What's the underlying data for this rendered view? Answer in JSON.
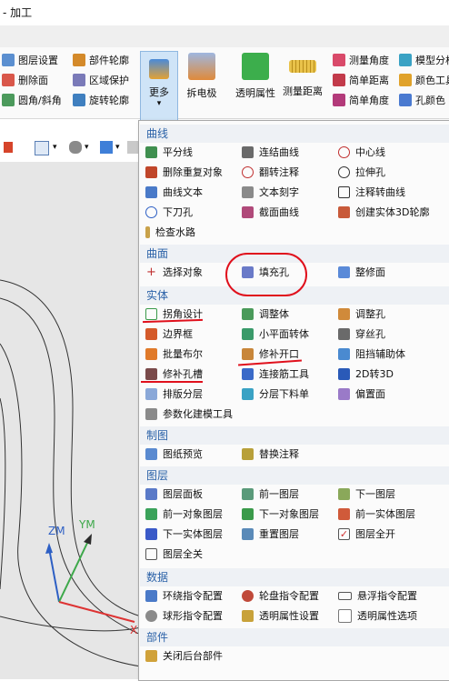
{
  "window": {
    "title": "- 加工"
  },
  "ribbon": {
    "col1": [
      "图层设置",
      "删除面",
      "圆角/斜角"
    ],
    "col2": [
      "部件轮廓",
      "区域保护",
      "旋转轮廓"
    ],
    "more": "更多",
    "electrode": "拆电极",
    "transparency": "透明属性",
    "measure_distance": "测量距离",
    "col3": [
      "测量角度",
      "简单距离",
      "简单角度"
    ],
    "col4": [
      "模型分析",
      "颜色工具",
      "孔颜色"
    ]
  },
  "axes": {
    "zm": "ZM",
    "ym": "YM",
    "x": "X"
  },
  "menu": {
    "sections": {
      "curve": "曲线",
      "surface": "曲面",
      "solid": "实体",
      "drafting": "制图",
      "layer": "图层",
      "data": "数据",
      "part": "部件"
    },
    "curve_items": [
      "平分线",
      "连结曲线",
      "中心线",
      "删除重复对象",
      "翻转注释",
      "拉伸孔",
      "曲线文本",
      "文本刻字",
      "注释转曲线",
      "下刀孔",
      "截面曲线",
      "创建实体3D轮廓",
      "检查水路"
    ],
    "surface_items": [
      "选择对象",
      "填充孔",
      "整修面"
    ],
    "solid_items": [
      "拐角设计",
      "调整体",
      "调整孔",
      "边界框",
      "小平面转体",
      "穿丝孔",
      "批量布尔",
      "修补开口",
      "阻挡辅助体",
      "修补孔槽",
      "连接筋工具",
      "2D转3D",
      "排版分层",
      "分层下料单",
      "偏置面",
      "参数化建模工具"
    ],
    "drafting_items": [
      "图纸预览",
      "替换注释"
    ],
    "layer_items": [
      "图层面板",
      "前一图层",
      "下一图层",
      "前一对象图层",
      "下一对象图层",
      "前一实体图层",
      "下一实体图层",
      "重置图层",
      "图层全开",
      "图层全关"
    ],
    "data_items": [
      "环绕指令配置",
      "轮盘指令配置",
      "悬浮指令配置",
      "球形指令配置",
      "透明属性设置",
      "透明属性选项"
    ],
    "part_items": [
      "关闭后台部件"
    ]
  },
  "colors": {
    "section_bg": "#eef1f5",
    "section_text": "#2b62a8",
    "annotation": "#e0101c",
    "menu_border": "#a8a8a8"
  }
}
